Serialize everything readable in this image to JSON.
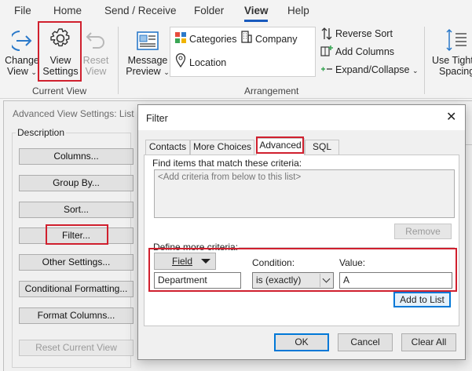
{
  "ribbon": {
    "tabs": [
      "File",
      "Home",
      "Send / Receive",
      "Folder",
      "View",
      "Help"
    ],
    "active_tab": "View",
    "current_view": {
      "change_view": [
        "Change",
        "View"
      ],
      "view_settings": [
        "View",
        "Settings"
      ],
      "reset_view": [
        "Reset",
        "View"
      ],
      "group_title": "Current View"
    },
    "arrangement": {
      "message_preview": [
        "Message",
        "Preview"
      ],
      "categories": "Categories",
      "company": "Company",
      "location": "Location",
      "reverse_sort": "Reverse Sort",
      "add_columns": "Add Columns",
      "expand_collapse": "Expand/Collapse",
      "group_title": "Arrangement"
    },
    "layout": {
      "use_tighter": [
        "Use Tight",
        "Spacing"
      ]
    }
  },
  "advanced_view_settings": {
    "title": "Advanced View Settings: List",
    "description_label": "Description",
    "buttons": {
      "columns": "Columns...",
      "group_by": "Group By...",
      "sort": "Sort...",
      "filter": "Filter...",
      "other_settings": "Other Settings...",
      "conditional_formatting": "Conditional Formatting...",
      "format_columns": "Format Columns...",
      "reset_current_view": "Reset Current View"
    }
  },
  "filter_dialog": {
    "title": "Filter",
    "tabs": [
      "Contacts",
      "More Choices",
      "Advanced",
      "SQL"
    ],
    "active_tab": "Advanced",
    "find_items_label": "Find items that match these criteria:",
    "criteria_placeholder": "<Add criteria from below to this list>",
    "remove_button": "Remove",
    "define_more_label": "Define more criteria:",
    "field_button": "Field",
    "condition_label": "Condition:",
    "value_label": "Value:",
    "field_value": "Department",
    "condition_value": "is (exactly)",
    "value_value": "A",
    "add_to_list_button": "Add to List",
    "ok_button": "OK",
    "cancel_button": "Cancel",
    "clear_all_button": "Clear All"
  },
  "colors": {
    "highlight_red": "#d0202e",
    "accent_blue": "#185abd",
    "focus_blue": "#0078d7"
  }
}
